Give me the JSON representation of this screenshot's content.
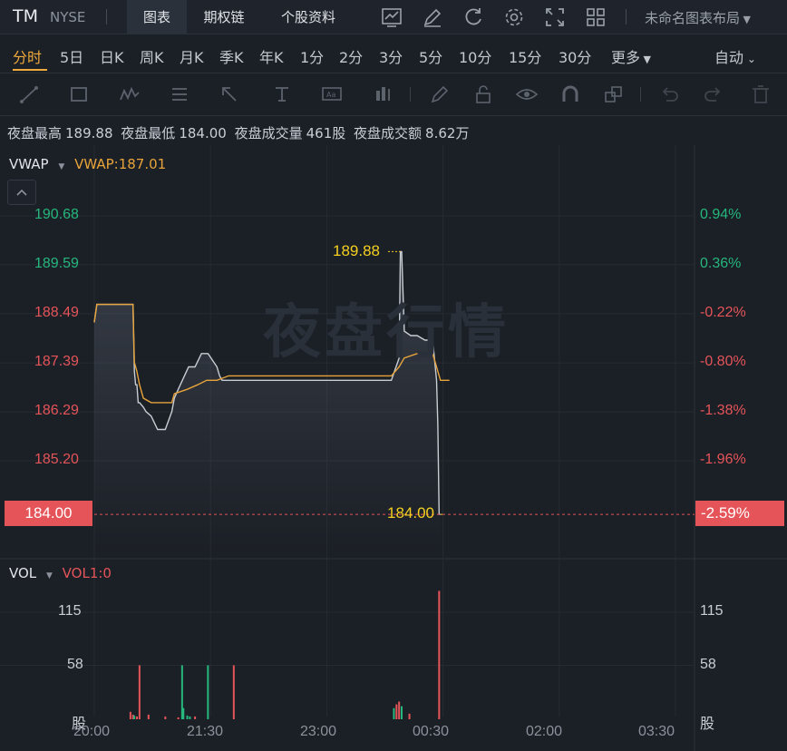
{
  "header": {
    "symbol": "TM",
    "exchange": "NYSE",
    "tabs": [
      {
        "label": "图表"
      },
      {
        "label": "期权链"
      },
      {
        "label": "个股资料"
      }
    ],
    "layout_name": "未命名图表布局",
    "icons": [
      "chart-type-icon",
      "draw-icon",
      "refresh-icon",
      "settings-icon",
      "fullscreen-icon",
      "layout-grid-icon"
    ]
  },
  "periods": {
    "items": [
      "分时",
      "5日",
      "日K",
      "周K",
      "月K",
      "季K",
      "年K",
      "1分",
      "2分",
      "3分",
      "5分",
      "10分",
      "15分",
      "30分",
      "更多"
    ],
    "active": "分时",
    "auto_label": "自动"
  },
  "stats": {
    "high_label": "夜盘最高",
    "high_value": "189.88",
    "low_label": "夜盘最低",
    "low_value": "184.00",
    "volume_label": "夜盘成交量",
    "volume_value": "461股",
    "amount_label": "夜盘成交额",
    "amount_value": "8.62万"
  },
  "indicator": {
    "name": "VWAP",
    "value_label": "VWAP:187.01",
    "vol_name": "VOL",
    "vol_value_label": "VOL1:0"
  },
  "watermark": "夜盘行情",
  "colors": {
    "up": "#26b77d",
    "down": "#e45459",
    "price_line": "#c8cdd4",
    "vwap_line": "#e8a43a",
    "annotation": "#f5d020"
  },
  "y_axis_left": [
    "190.68",
    "189.59",
    "188.49",
    "187.39",
    "186.29",
    "185.20"
  ],
  "y_axis_right": [
    "0.94%",
    "0.36%",
    "-0.22%",
    "-0.80%",
    "-1.38%",
    "-1.96%"
  ],
  "current_price": "184.00",
  "current_pct": "-2.59%",
  "annotations": {
    "high": "189.88",
    "low": "184.00"
  },
  "vol_axis": [
    "115",
    "58",
    "股"
  ],
  "x_axis": [
    "20:00",
    "21:30",
    "23:00",
    "00:30",
    "02:00",
    "03:30"
  ],
  "chart_data": {
    "type": "line",
    "x_unit": "minutes since 20:00",
    "ylim": [
      183.6,
      191.4
    ],
    "price": {
      "name": "",
      "x": [
        0,
        2,
        30,
        31,
        32,
        33,
        34,
        35,
        38,
        40,
        44,
        49,
        55,
        60,
        62,
        65,
        73,
        78,
        83,
        88,
        95,
        97,
        99,
        104,
        140,
        200,
        230,
        236,
        237,
        238,
        240,
        245,
        250,
        256,
        262,
        265,
        266,
        267,
        268
      ],
      "y": [
        188.3,
        188.7,
        188.7,
        187.2,
        186.9,
        186.9,
        186.5,
        186.5,
        186.4,
        186.3,
        186.2,
        185.9,
        185.9,
        186.3,
        186.6,
        186.8,
        187.3,
        187.3,
        187.6,
        187.6,
        187.3,
        187.1,
        187.0,
        187.0,
        187.0,
        187.0,
        187.0,
        187.5,
        189.88,
        189.88,
        188.1,
        188.0,
        188.0,
        187.9,
        187.9,
        187.0,
        186.0,
        184.0,
        184.0
      ]
    },
    "vwap": {
      "name": "VWAP",
      "x": [
        0,
        2,
        30,
        31,
        33,
        35,
        38,
        44,
        60,
        62,
        72,
        80,
        87,
        95,
        104,
        140,
        200,
        230,
        236,
        240,
        250,
        256,
        262,
        268,
        275
      ],
      "y": [
        188.3,
        188.7,
        188.7,
        187.4,
        187.2,
        186.9,
        186.6,
        186.5,
        186.5,
        186.7,
        186.8,
        186.9,
        187.0,
        187.0,
        187.1,
        187.1,
        187.1,
        187.1,
        187.3,
        187.5,
        187.6,
        187.6,
        187.6,
        187.0,
        187.0
      ]
    },
    "volume": {
      "name": "VOL",
      "ylim": [
        0,
        140
      ],
      "bars": [
        {
          "x": 28,
          "v": 8,
          "dir": "down"
        },
        {
          "x": 30,
          "v": 5,
          "dir": "down"
        },
        {
          "x": 31,
          "v": 4,
          "dir": "up"
        },
        {
          "x": 33,
          "v": 3,
          "dir": "down"
        },
        {
          "x": 35,
          "v": 58,
          "dir": "down"
        },
        {
          "x": 42,
          "v": 5,
          "dir": "down"
        },
        {
          "x": 55,
          "v": 3,
          "dir": "down"
        },
        {
          "x": 65,
          "v": 2,
          "dir": "down"
        },
        {
          "x": 68,
          "v": 58,
          "dir": "up"
        },
        {
          "x": 69,
          "v": 12,
          "dir": "up"
        },
        {
          "x": 72,
          "v": 4,
          "dir": "up"
        },
        {
          "x": 74,
          "v": 3,
          "dir": "up"
        },
        {
          "x": 78,
          "v": 3,
          "dir": "down"
        },
        {
          "x": 88,
          "v": 58,
          "dir": "up"
        },
        {
          "x": 108,
          "v": 58,
          "dir": "down"
        },
        {
          "x": 232,
          "v": 12,
          "dir": "up"
        },
        {
          "x": 234,
          "v": 16,
          "dir": "down"
        },
        {
          "x": 236,
          "v": 19,
          "dir": "down"
        },
        {
          "x": 238,
          "v": 14,
          "dir": "up"
        },
        {
          "x": 244,
          "v": 6,
          "dir": "down"
        },
        {
          "x": 267,
          "v": 138,
          "dir": "down"
        }
      ]
    }
  }
}
